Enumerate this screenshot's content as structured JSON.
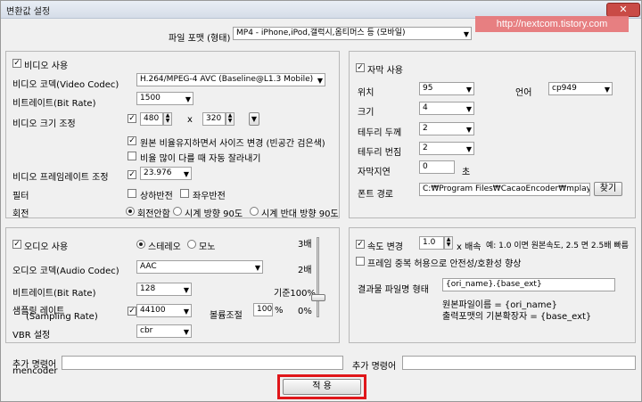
{
  "window": {
    "title": "변환값 설정",
    "close": "✕"
  },
  "watermark": "http://nextcom.tistory.com",
  "format": {
    "label": "파일 포맷 (형태)",
    "value": "MP4 - iPhone,iPod,갤럭시,옴티머스 등 (모바일)"
  },
  "video": {
    "use_label": "비디오 사용",
    "use_checked": "✓",
    "codec_label": "비디오 코덱(Video Codec)",
    "codec_value": "H.264/MPEG-4 AVC (Baseline@L1.3 Mobile)",
    "bitrate_label": "비트레이트(Bit Rate)",
    "bitrate_value": "1500",
    "size_label": "비디오 크기 조정",
    "size_checked": "✓",
    "width": "480",
    "x": "x",
    "height": "320",
    "size_btn": "▼",
    "keep_ratio_label": "원본 비율유지하면서 사이즈 변경 (빈공간 검은색)",
    "keep_ratio_checked": "✓",
    "crop_label": "비율 많이 다를 때 자동 잘라내기",
    "framerate_label": "비디오 프레임레이트 조정",
    "framerate_checked": "✓",
    "framerate_value": "23.976",
    "filter_label": "필터",
    "flip_v": "상하반전",
    "flip_h": "좌우반전",
    "rotate_label": "회전",
    "rot_none": "회전안함",
    "rot_cw": "시계 방향 90도",
    "rot_ccw": "시계 반대 방향 90도"
  },
  "subtitle": {
    "use_label": "자막 사용",
    "use_checked": "✓",
    "position_label": "위치",
    "position_value": "95",
    "lang_label": "언어",
    "lang_value": "cp949",
    "size_label": "크기",
    "size_value": "4",
    "border_label": "테두리 두께",
    "border_value": "2",
    "blur_label": "테두리 번짐",
    "blur_value": "2",
    "delay_label": "자막지연",
    "delay_value": "0",
    "delay_unit": "초",
    "font_label": "폰트 경로",
    "font_value": "C:₩Program Files₩CacaoEncoder₩mplaye",
    "browse": "찾기"
  },
  "audio": {
    "use_label": "오디오 사용",
    "use_checked": "✓",
    "stereo": "스테레오",
    "mono": "모노",
    "codec_label": "오디오 코덱(Audio Codec)",
    "codec_value": "AAC",
    "bitrate_label": "비트레이트(Bit Rate)",
    "bitrate_value": "128",
    "sampling_label1": "샘플링 레이트",
    "sampling_label2": "(Sampling Rate)",
    "sampling_checked": "✓",
    "sampling_value": "44100",
    "volume_label": "볼륨조절",
    "volume_value": "100",
    "volume_unit": "%",
    "vbr_label": "VBR 설정",
    "vbr_value": "cbr",
    "scale_top": "3배",
    "scale_2": "2배",
    "scale_base": "기준100%",
    "scale_zero": "0%",
    "slider_level": 0.25
  },
  "speed": {
    "use_label": "속도 변경",
    "use_checked": "✓",
    "value": "1.0",
    "unit": "x 배속",
    "hint": "예: 1.0 이면 원본속도, 2.5 면 2.5배 빠름",
    "dup_label": "프레임 중복 허용으로 안전성/호환성 향상",
    "outname_label": "결과물 파일명 형태",
    "outname_value": "{ori_name}.{base_ext}",
    "note1": "원본파일이름 = {ori_name}",
    "note2": "출력포맷의 기본확장자 = {base_ext}"
  },
  "extra": {
    "left_label1": "추가 명령어",
    "left_label2": "mencoder",
    "right_label": "추가 명령어"
  },
  "apply": "적 용"
}
